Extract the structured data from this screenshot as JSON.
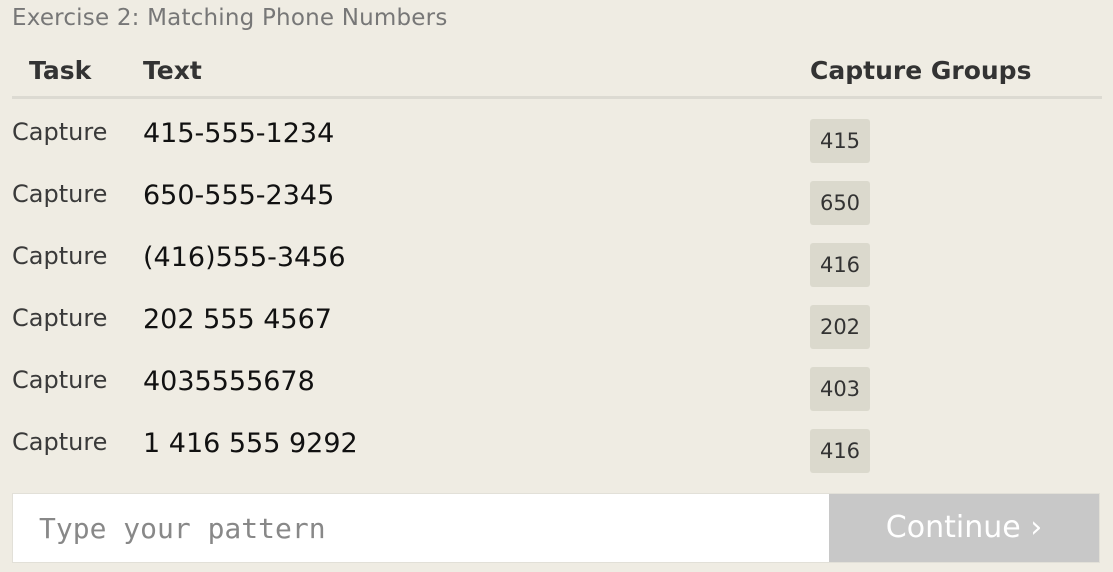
{
  "exercise": {
    "title": "Exercise 2: Matching Phone Numbers"
  },
  "table": {
    "headers": {
      "task": "Task",
      "text": "Text",
      "groups": "Capture Groups"
    },
    "rows": [
      {
        "task": "Capture",
        "text": "415-555-1234",
        "group": "415"
      },
      {
        "task": "Capture",
        "text": "650-555-2345",
        "group": "650"
      },
      {
        "task": "Capture",
        "text": "(416)555-3456",
        "group": "416"
      },
      {
        "task": "Capture",
        "text": "202 555 4567",
        "group": "202"
      },
      {
        "task": "Capture",
        "text": "4035555678",
        "group": "403"
      },
      {
        "task": "Capture",
        "text": "1 416 555 9292",
        "group": "416"
      }
    ]
  },
  "input": {
    "placeholder": "Type your pattern",
    "value": ""
  },
  "continue": {
    "label": "Continue ›"
  },
  "colors": {
    "background": "#efece3",
    "chip": "#dbd9cd",
    "button_disabled": "#c8c8c8"
  }
}
